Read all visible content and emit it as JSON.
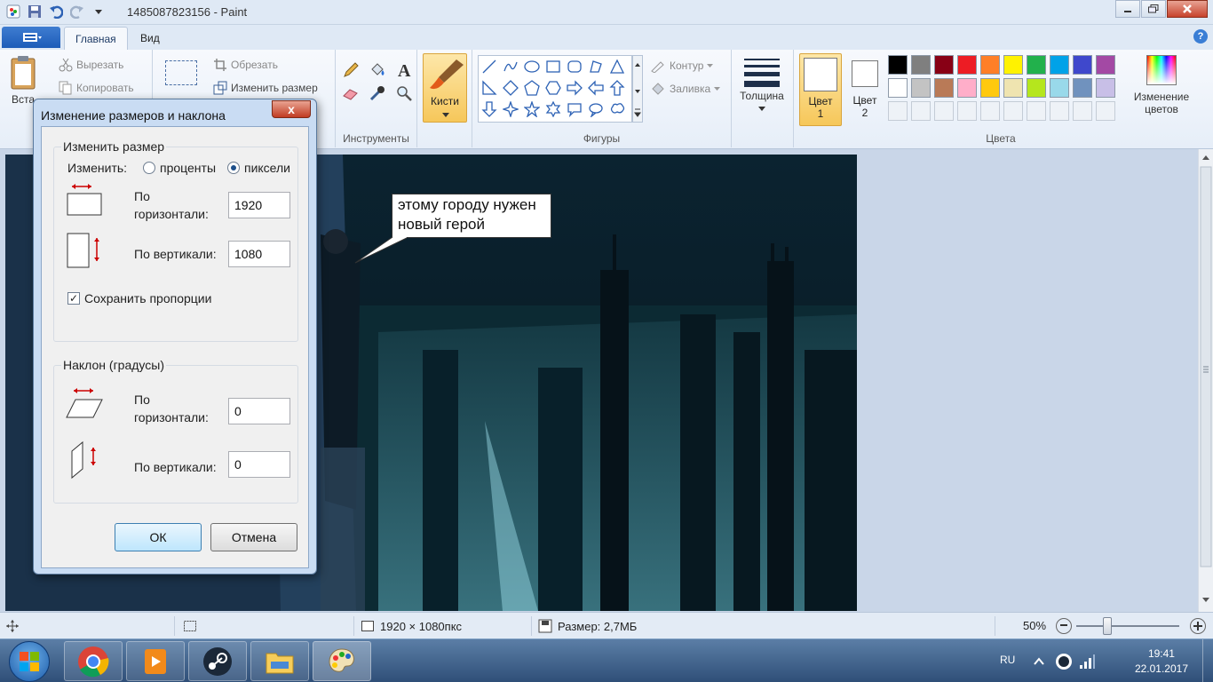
{
  "window": {
    "title": "1485087823156 - Paint"
  },
  "tabs": {
    "home": "Главная",
    "view": "Вид"
  },
  "help": "?",
  "clipboard": {
    "paste": "Вста",
    "cut": "Вырезать",
    "copy": "Копировать"
  },
  "image_group": {
    "crop": "Обрезать",
    "resize": "Изменить размер"
  },
  "tools": {
    "label": "Инструменты"
  },
  "brushes": {
    "label": "Кисти"
  },
  "shapes": {
    "label": "Фигуры",
    "outline": "Контур",
    "fill": "Заливка"
  },
  "size": {
    "label": "Толщина"
  },
  "colors": {
    "color1": "Цвет",
    "color1_num": "1",
    "color2": "Цвет",
    "color2_num": "2",
    "edit_line1": "Изменение",
    "edit_line2": "цветов",
    "label": "Цвета",
    "palette_row1": [
      "#000000",
      "#7f7f7f",
      "#880015",
      "#ed1c24",
      "#ff7f27",
      "#fff200",
      "#22b14c",
      "#00a2e8",
      "#3f48cc",
      "#a349a4"
    ],
    "palette_row2": [
      "#ffffff",
      "#c3c3c3",
      "#b97a57",
      "#ffaec9",
      "#ffc90e",
      "#efe4b0",
      "#b5e61d",
      "#99d9ea",
      "#7092be",
      "#c8bfe7"
    ]
  },
  "canvas": {
    "bubble_line1": "этому городу нужен",
    "bubble_line2": "новый герой"
  },
  "dialog": {
    "title": "Изменение размеров и наклона",
    "close": "x",
    "resize_legend": "Изменить размер",
    "change_by": "Изменить:",
    "percent": "проценты",
    "pixels": "пиксели",
    "h_label_1": "По",
    "h_label_2": "горизонтали:",
    "h_value": "1920",
    "v_label": "По вертикали:",
    "v_value": "1080",
    "keep_ratio": "Сохранить пропорции",
    "skew_legend": "Наклон (градусы)",
    "skew_h_label_1": "По",
    "skew_h_label_2": "горизонтали:",
    "skew_h_value": "0",
    "skew_v_label": "По вертикали:",
    "skew_v_value": "0",
    "ok": "ОК",
    "cancel": "Отмена"
  },
  "status": {
    "dimensions": "1920 × 1080пкс",
    "size": "Размер: 2,7МБ",
    "zoom": "50%"
  },
  "tray": {
    "lang": "RU",
    "time": "19:41",
    "date": "22.01.2017"
  }
}
